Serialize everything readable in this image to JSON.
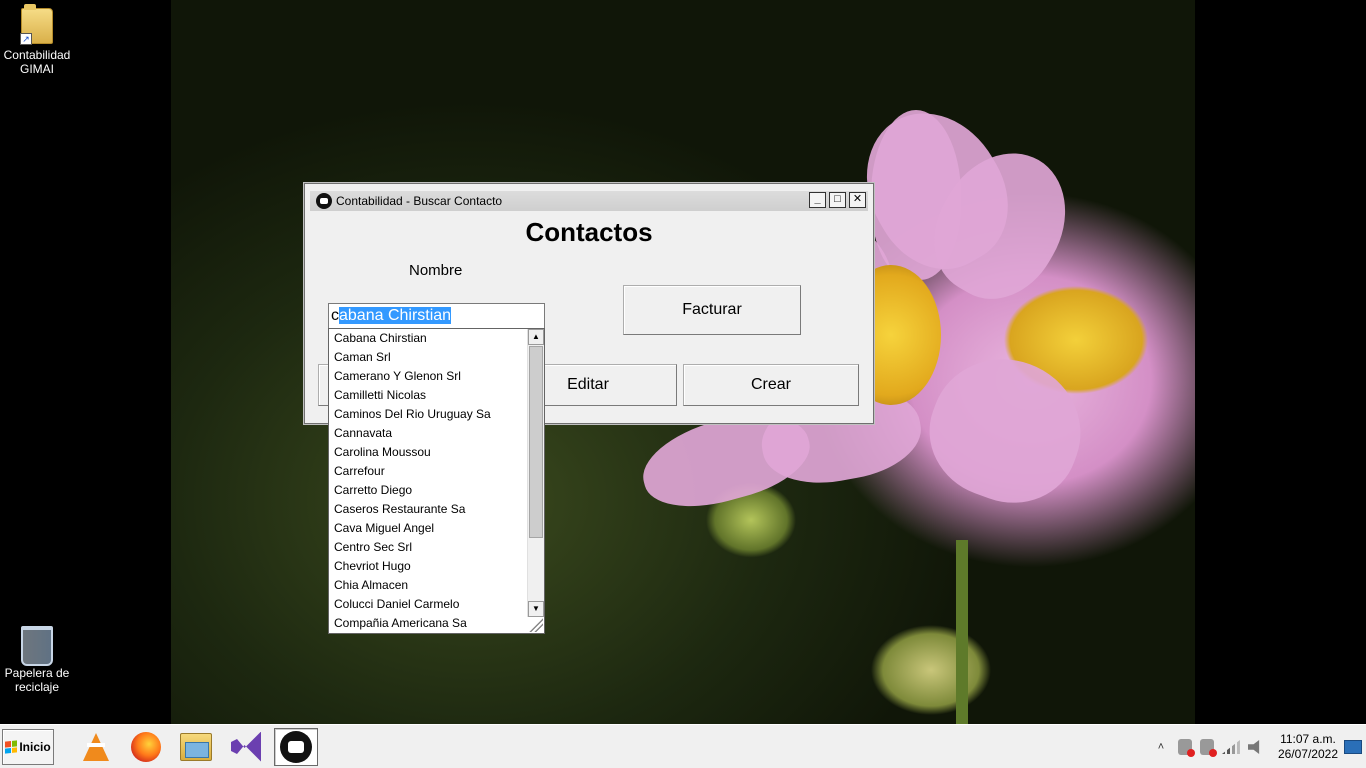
{
  "desktop": {
    "icons": [
      {
        "label": "Contabilidad GIMAI",
        "icon": "folder-shortcut-icon"
      },
      {
        "label": "Papelera de reciclaje",
        "icon": "recycle-bin-icon"
      }
    ]
  },
  "window": {
    "title": "Contabilidad - Buscar Contacto",
    "minimize": "_",
    "maximize": "□",
    "close": "✕",
    "heading": "Contactos",
    "nombre_label": "Nombre",
    "search": {
      "value_prefix": "c",
      "value_selected": "abana Chirstian"
    },
    "buttons": {
      "facturar": "Facturar",
      "editar": "Editar",
      "crear": "Crear"
    }
  },
  "dropdown": {
    "items": [
      "Cabana Chirstian",
      "Caman Srl",
      "Camerano Y Glenon Srl",
      "Camilletti Nicolas",
      "Caminos Del Rio Uruguay Sa",
      "Cannavata",
      "Carolina Moussou",
      "Carrefour",
      "Carretto Diego",
      "Caseros Restaurante Sa",
      "Cava Miguel Angel",
      "Centro Sec Srl",
      "Chevriot Hugo",
      "Chia Almacen",
      "Colucci Daniel Carmelo",
      "Compañia Americana Sa"
    ],
    "scroll_up": "▲",
    "scroll_down": "▼"
  },
  "taskbar": {
    "start_label": "Inicio",
    "apps": [
      "vlc-icon",
      "firefox-icon",
      "file-explorer-icon",
      "visual-studio-icon",
      "gimai-app-icon"
    ],
    "tray": {
      "show_hidden": "˄",
      "time": "11:07 a.m.",
      "date": "26/07/2022"
    }
  },
  "colors": {
    "selection": "#3399ff",
    "window_bg": "#f0f0f0",
    "taskbar_bg": "#f0f0f0"
  }
}
